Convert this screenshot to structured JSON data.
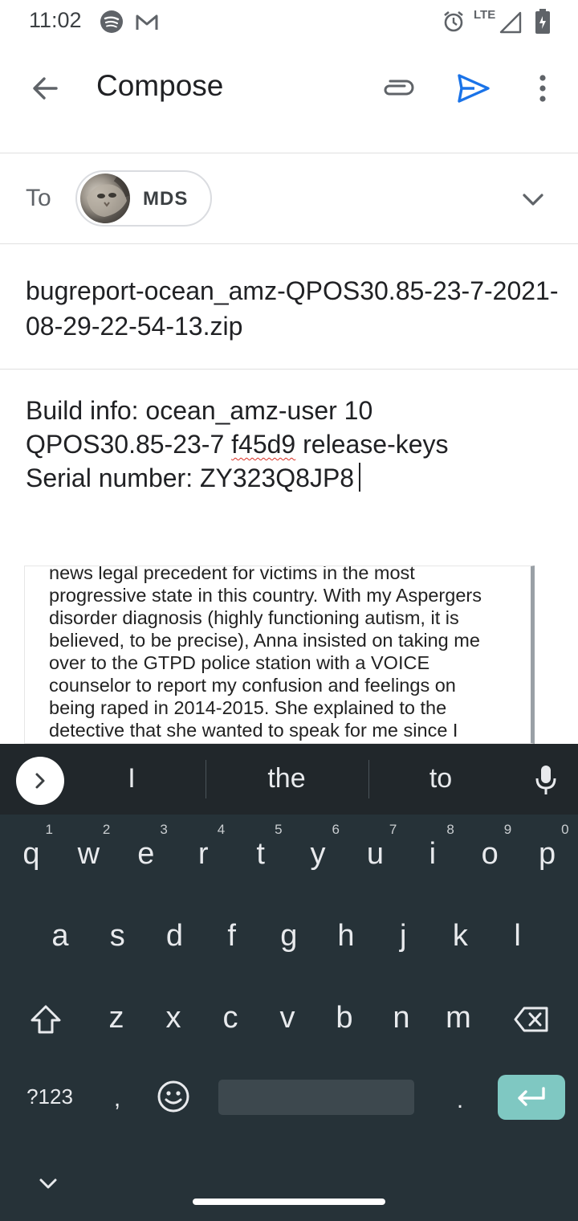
{
  "status_bar": {
    "time": "11:02",
    "network": "LTE",
    "icons": [
      "spotify-icon",
      "gmail-icon",
      "alarm-icon",
      "signal-icon",
      "battery-icon"
    ]
  },
  "app_bar": {
    "title": "Compose",
    "icons": [
      "back-arrow-icon",
      "attach-icon",
      "send-icon",
      "more-vert-icon"
    ],
    "accent_color": "#1a73e8"
  },
  "recipients": {
    "to_label": "To",
    "chips": [
      {
        "label": "MDS"
      }
    ]
  },
  "subject": "bugreport-ocean_amz-QPOS30.85-23-7-2021-08-29-22-54-13.zip",
  "body": {
    "lines": [
      "Build info: ocean_amz-user 10",
      "QPOS30.85-23-7 f45d9 release-keys",
      "Serial number: ZY323Q8JP8"
    ],
    "line2_parts": [
      "QPOS30.85-23-7 ",
      "f45d9",
      " release-keys"
    ],
    "misspelled_word": "f45d9"
  },
  "attachment_preview": {
    "lines": [
      "news legal precedent for victims in the most",
      "progressive state in this country. With my Aspergers",
      "disorder diagnosis (highly functioning autism, it is",
      "believed, to be precise), Anna insisted on taking me",
      "over to the GTPD police station with a VOICE",
      "counselor to report my confusion and feelings on",
      "being raped in 2014-2015. She explained to the",
      "detective that she wanted to speak for me since I"
    ]
  },
  "keyboard": {
    "suggestions": [
      "I",
      "the",
      "to"
    ],
    "row1": [
      {
        "k": "q",
        "n": "1"
      },
      {
        "k": "w",
        "n": "2"
      },
      {
        "k": "e",
        "n": "3"
      },
      {
        "k": "r",
        "n": "4"
      },
      {
        "k": "t",
        "n": "5"
      },
      {
        "k": "y",
        "n": "6"
      },
      {
        "k": "u",
        "n": "7"
      },
      {
        "k": "i",
        "n": "8"
      },
      {
        "k": "o",
        "n": "9"
      },
      {
        "k": "p",
        "n": "0"
      }
    ],
    "row2": [
      "a",
      "s",
      "d",
      "f",
      "g",
      "h",
      "j",
      "k",
      "l"
    ],
    "row3": [
      "z",
      "x",
      "c",
      "v",
      "b",
      "n",
      "m"
    ],
    "symbols_label": "?123",
    "comma": ",",
    "period": ".",
    "enter_color": "#7fc8c2",
    "background_color": "#263238"
  }
}
